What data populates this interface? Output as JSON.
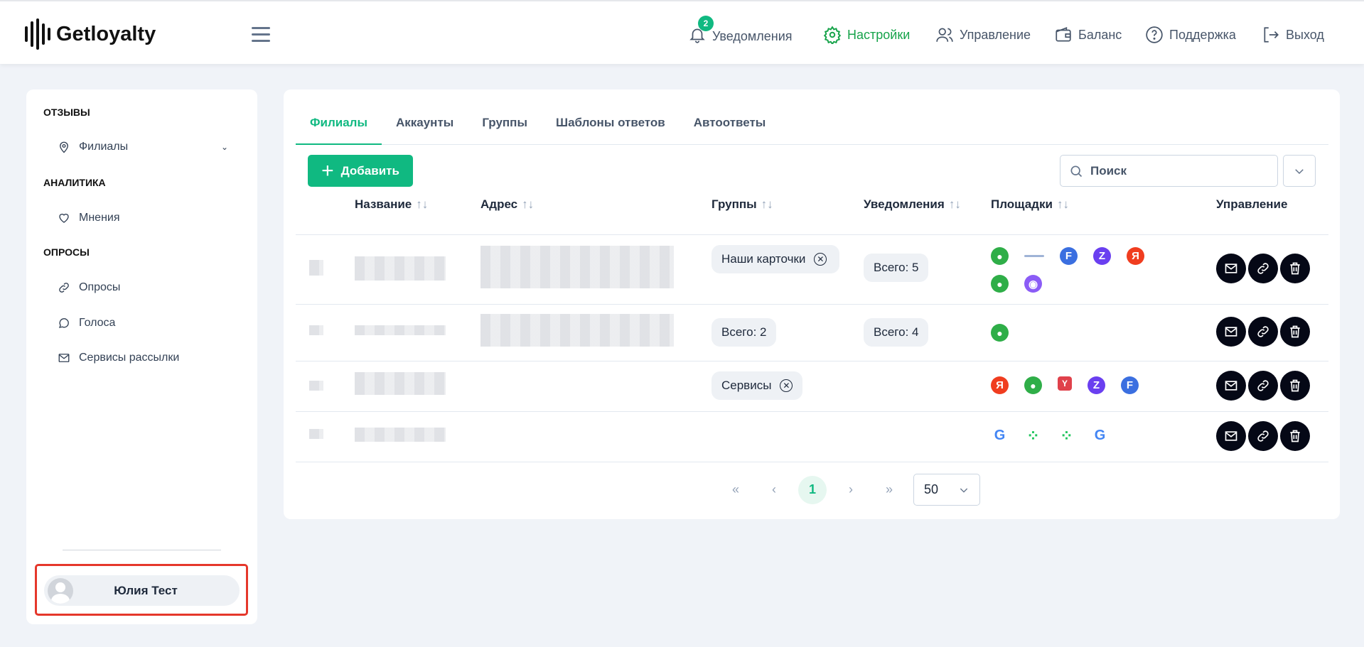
{
  "header": {
    "brand": "Getloyalty",
    "notifications_count": "2",
    "nav": [
      {
        "label": "Уведомления",
        "icon": "bell-icon"
      },
      {
        "label": "Настройки",
        "icon": "gear-icon",
        "active": true
      },
      {
        "label": "Управление",
        "icon": "users-icon"
      },
      {
        "label": "Баланс",
        "icon": "wallet-icon"
      },
      {
        "label": "Поддержка",
        "icon": "help-icon"
      },
      {
        "label": "Выход",
        "icon": "logout-icon"
      }
    ]
  },
  "sidebar": {
    "sections": [
      {
        "title": "ОТЗЫВЫ"
      },
      {
        "title": "АНАЛИТИКА"
      },
      {
        "title": "ОПРОСЫ"
      }
    ],
    "items": [
      {
        "label": "Филиалы"
      },
      {
        "label": "Мнения"
      },
      {
        "label": "Опросы"
      },
      {
        "label": "Голоса"
      },
      {
        "label": "Сервисы рассылки"
      }
    ],
    "user": "Юлия Тест"
  },
  "main": {
    "tabs": [
      "Филиалы",
      "Аккаунты",
      "Группы",
      "Шаблоны ответов",
      "Автоответы"
    ],
    "add_label": "Добавить",
    "search_placeholder": "Поиск",
    "columns": [
      "Название",
      "Адрес",
      "Группы",
      "Уведомления",
      "Площадки",
      "Управление"
    ],
    "sort_glyph": "↑↓",
    "rows": [
      {
        "group": "Наши карточки",
        "group_removable": true,
        "notifications": "Всего: 5",
        "platforms": [
          "2gis",
          "organizer",
          "tf",
          "zoon",
          "yandex",
          "2gis",
          "globe"
        ]
      },
      {
        "group": "Всего: 2",
        "group_removable": false,
        "notifications": "Всего: 4",
        "platforms": [
          "2gis"
        ]
      },
      {
        "group": "Сервисы",
        "group_removable": true,
        "notifications": "",
        "platforms": [
          "yandex",
          "2gis",
          "yell",
          "zoon",
          "tf"
        ]
      },
      {
        "group": "",
        "group_removable": false,
        "notifications": "",
        "platforms": [
          "google",
          "dots",
          "dots",
          "google"
        ]
      }
    ],
    "pagination": {
      "first": "«",
      "prev": "‹",
      "current": "1",
      "next": "›",
      "last": "»",
      "page_size": "50"
    }
  },
  "colors": {
    "accent": "#10b981",
    "action": "#050816",
    "highlight": "#e5372b"
  }
}
